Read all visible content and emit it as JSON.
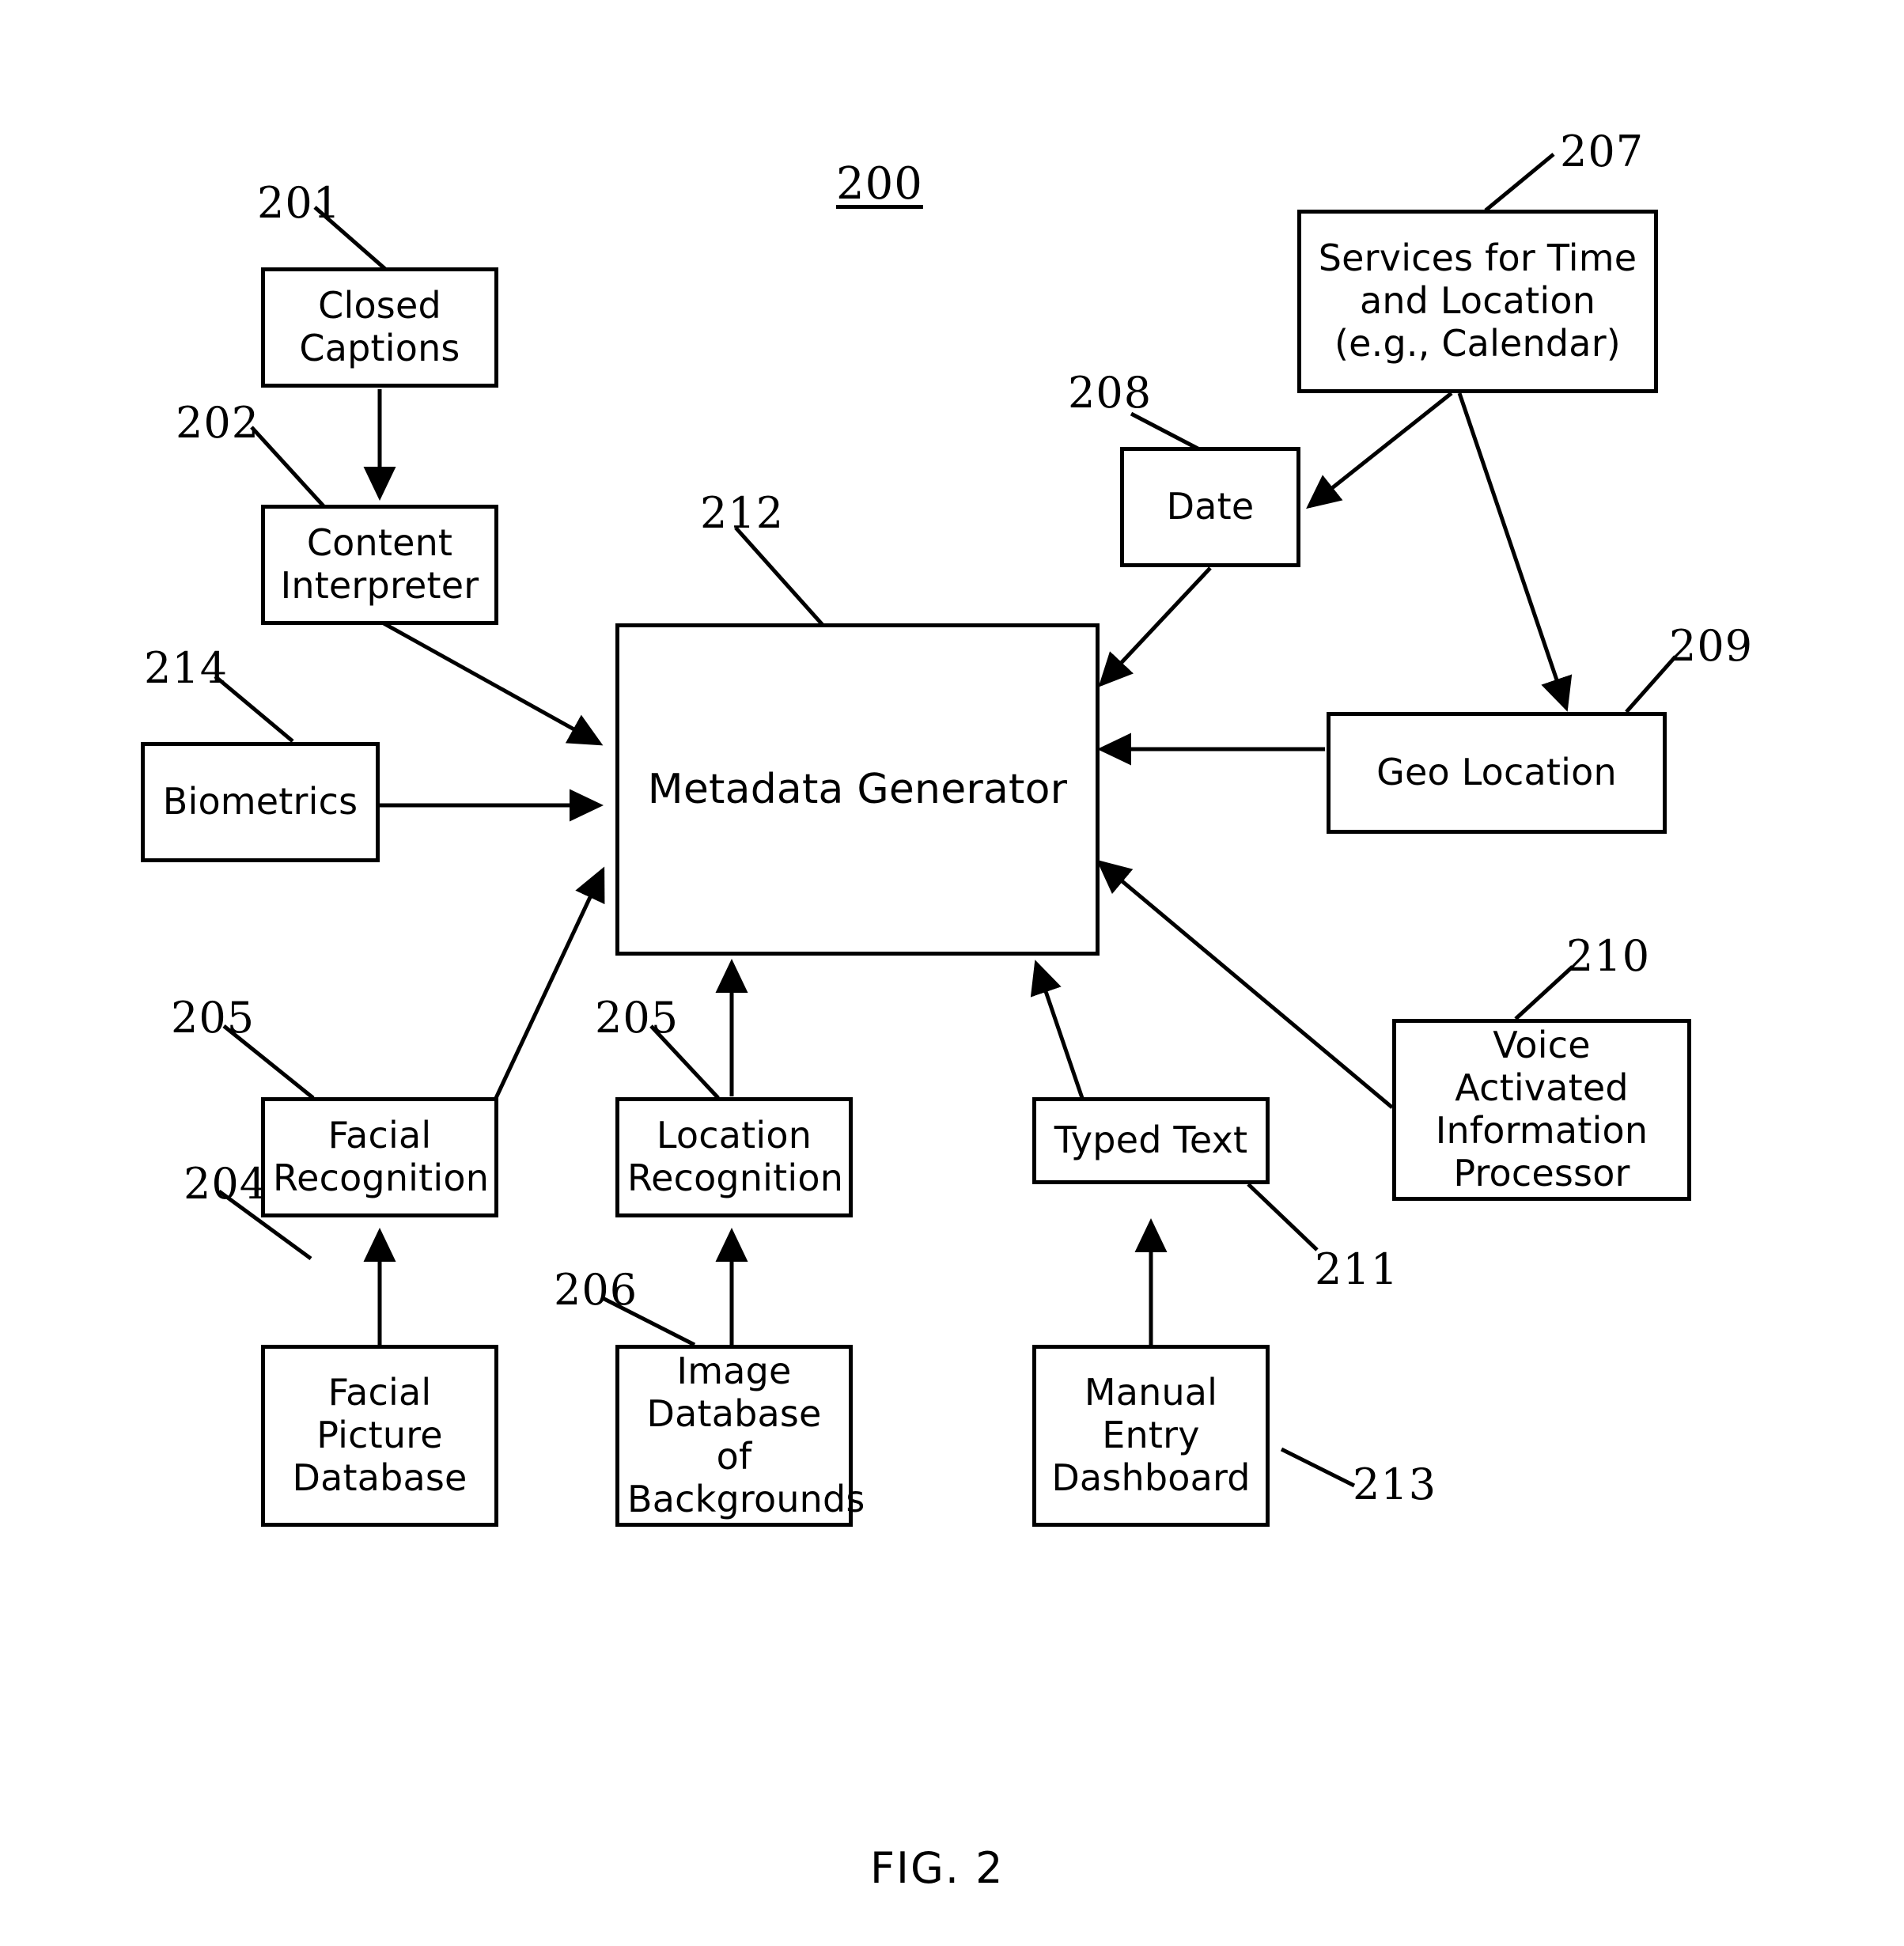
{
  "figure": {
    "number": "200",
    "caption": "FIG. 2"
  },
  "nodes": {
    "closed_captions": "Closed Captions",
    "content_interpreter": "Content Interpreter",
    "biometrics": "Biometrics",
    "facial_recognition": "Facial Recognition",
    "facial_picture_database": "Facial Picture Database",
    "location_recognition": "Location Recognition",
    "image_database_of_backgrounds": "Image Database of Backgrounds",
    "typed_text": "Typed Text",
    "manual_entry_dashboard": "Manual Entry Dashboard",
    "metadata_generator": "Metadata Generator",
    "services_time_location": "Services for Time and Location (e.g., Calendar)",
    "date": "Date",
    "geo_location": "Geo Location",
    "voice_activated_information_processor": "Voice Activated Information Processor"
  },
  "reference_numerals": {
    "closed_captions": "201",
    "content_interpreter": "202",
    "facial_picture_database": "204",
    "facial_recognition": "205",
    "location_recognition": "205",
    "image_database_of_backgrounds": "206",
    "services_time_location": "207",
    "date": "208",
    "geo_location": "209",
    "voice_activated_information_processor": "210",
    "typed_text": "211",
    "metadata_generator": "212",
    "manual_entry_dashboard": "213",
    "biometrics": "214"
  },
  "colors": {
    "stroke": "#000000",
    "background": "#ffffff"
  }
}
